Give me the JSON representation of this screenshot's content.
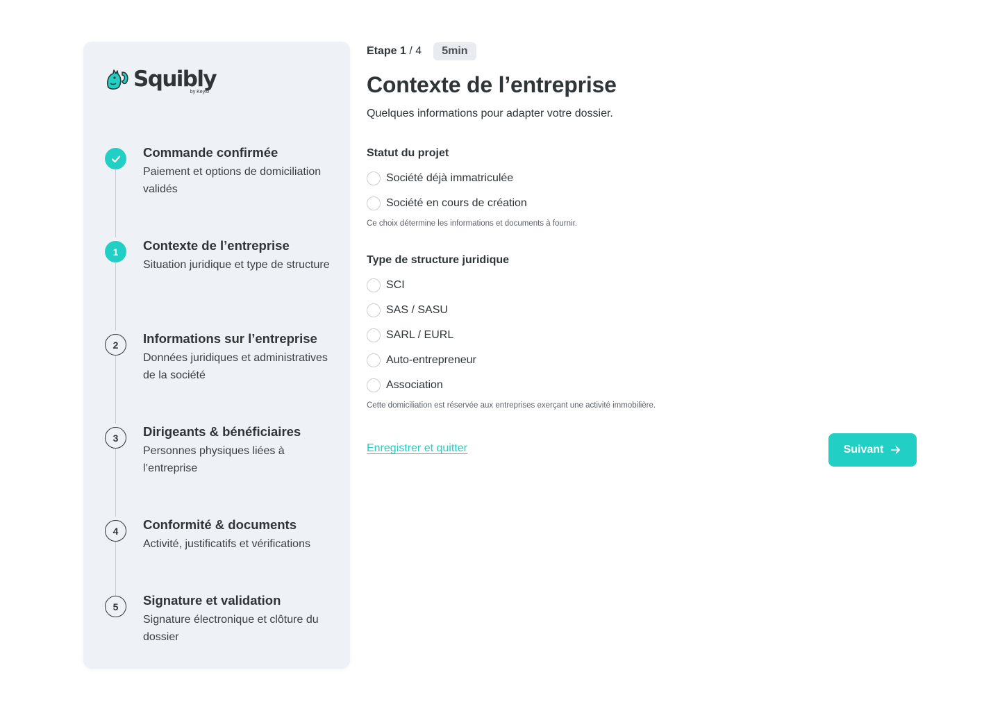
{
  "brand": {
    "name": "Squibly",
    "tagline": "by Keyto",
    "color": "#21cfc4"
  },
  "sidebar": {
    "steps": [
      {
        "marker": "",
        "status": "done",
        "icon": "check-icon",
        "title": "Commande confirmée",
        "description": "Paiement et options de domiciliation validés"
      },
      {
        "marker": "1",
        "status": "active",
        "title": "Contexte de l’entreprise",
        "description": "Situation juridique et type de structure"
      },
      {
        "marker": "2",
        "status": "todo",
        "title": "Informations sur l’entreprise",
        "description": "Données juridiques et administratives de la société"
      },
      {
        "marker": "3",
        "status": "todo",
        "title": "Dirigeants & bénéficiaires",
        "description": "Personnes physiques liées à l’entreprise"
      },
      {
        "marker": "4",
        "status": "todo",
        "title": "Conformité & documents",
        "description": "Activité, justificatifs et vérifications"
      },
      {
        "marker": "5",
        "status": "todo",
        "title": "Signature et validation",
        "description": "Signature électronique et clôture du dossier"
      }
    ]
  },
  "header": {
    "step_label": "Etape",
    "step_current": "1",
    "step_total": "/ 4",
    "duration": "5min",
    "title": "Contexte de l’entreprise",
    "subtitle": "Quelques informations pour adapter votre dossier."
  },
  "project_status": {
    "title": "Statut du projet",
    "options": [
      "Société déjà immatriculée",
      "Société en cours de création"
    ],
    "hint": "Ce choix détermine les informations et documents à fournir."
  },
  "legal_structure": {
    "title": "Type de structure juridique",
    "options": [
      "SCI",
      "SAS / SASU",
      "SARL / EURL",
      "Auto-entrepreneur",
      "Association"
    ],
    "hint": "Cette domiciliation est réservée aux entreprises exerçant une activité immobilière."
  },
  "actions": {
    "save_label": "Enregistrer et quitter",
    "next_label": "Suivant",
    "next_icon": "arrow-right-icon"
  }
}
